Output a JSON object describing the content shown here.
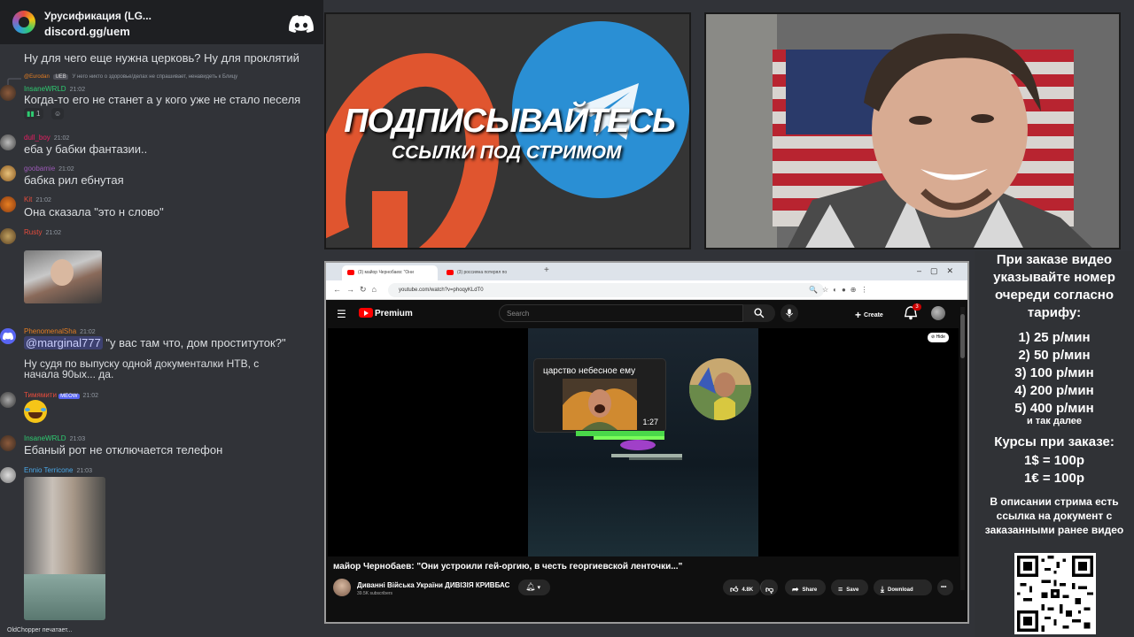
{
  "discord": {
    "server_name": "Урусификация (LG...",
    "invite": "discord.gg/uem",
    "messages": [
      {
        "text": "Ну для чего еще нужна церковь? Ну для проклятий"
      },
      {
        "reply_user": "@Eurodan",
        "reply_badge": "UEB",
        "reply_text": "У него никто о здоровье/делах не спрашивает, ненавидеть к Блицу",
        "name": "InsaneWRLD",
        "time": "21:02",
        "text": "Когда-то его не станет а у кого уже не стало песеля",
        "reaction_count": "1"
      },
      {
        "name": "dull_boy",
        "time": "21:02",
        "text": "еба у бабки фантазии.."
      },
      {
        "name": "goobamie",
        "time": "21:02",
        "text": "бабка рил ебнутая"
      },
      {
        "name": "Kit",
        "time": "21:02",
        "text": "Она сказала \"это н слово\""
      },
      {
        "name": "Rusty",
        "time": "21:02"
      },
      {
        "name": "PhenomenalSha",
        "time": "21:02",
        "mention": "@marginal777",
        "text": " \"у вас там что, дом проституток?\"",
        "text2_line1": "Ну судя по выпуску одной документалки НТВ, с",
        "text2_line2": "начала 90ых... да."
      },
      {
        "name": "Тимямити",
        "badge": "MEOW",
        "time": "21:02"
      },
      {
        "name": "InsaneWRLD",
        "time": "21:03",
        "text": "Ебаный рот не отключается телефон"
      },
      {
        "name": "Ennio Terricone",
        "time": "21:03"
      }
    ],
    "typing": "OldChopper печатает..."
  },
  "promo": {
    "title": "ПОДПИСЫВАЙТЕСЬ",
    "subtitle": "ССЫЛКИ ПОД СТРИМОМ"
  },
  "browser": {
    "tabs": [
      {
        "label": "(3) майор Чернобаев: \"Они"
      },
      {
        "label": "(3) россияна потерял по"
      }
    ],
    "url": "youtube.com/watch?v=phoqyKLdT0"
  },
  "youtube": {
    "brand": "Premium",
    "search_placeholder": "Search",
    "create": "Create",
    "notifications": "3",
    "hide": "Hide",
    "card_title": "царство небесное ему",
    "card_duration": "1:27",
    "video_title": "майор Чернобаев: \"Они устроили гей-оргию, в честь георгиевской ленточки...\"",
    "channel_name": "Диванні Війська України ДИВІЗІЯ КРИВБАС",
    "subscribers": "39.5K subscribers",
    "likes": "4.8K",
    "share": "Share",
    "save": "Save",
    "download": "Download"
  },
  "info": {
    "order_text": "При заказе видео указывайте номер очереди согласно тарифу:",
    "tariffs": [
      "1) 25 р/мин",
      "2) 50 р/мин",
      "3) 100 р/мин",
      "4) 200 р/мин",
      "5) 400 р/мин"
    ],
    "etc": "и так далее",
    "rates_title": "Курсы при заказе:",
    "rates": [
      "1$ = 100р",
      "1€ = 100р"
    ],
    "desc": "В описании стрима есть ссылка на документ с заказанными ранее видео"
  },
  "colors": {
    "discord_bg": "#313338",
    "promo_orange": "#e0552f",
    "telegram_blue": "#2a8fd4",
    "youtube_red": "#ff0000"
  }
}
